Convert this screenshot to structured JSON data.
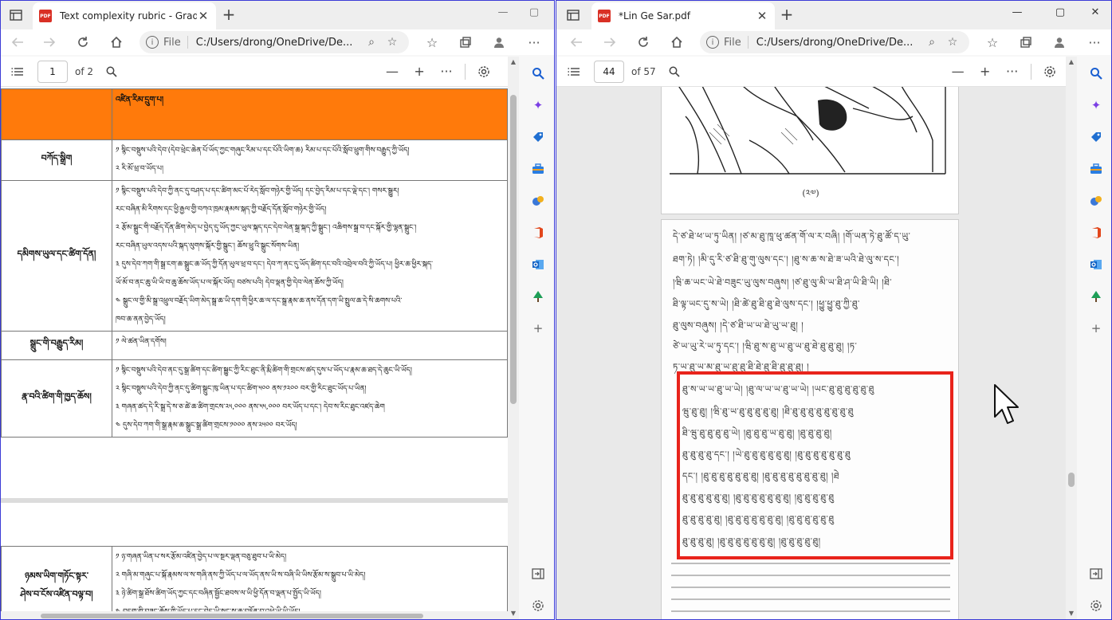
{
  "left_window": {
    "tab_title": "Text complexity rubric - Grade 6",
    "address": {
      "file_label": "File",
      "url": "C:/Users/drong/OneDrive/De..."
    },
    "pdf_toolbar": {
      "page": "1",
      "of": "of 2"
    },
    "document": {
      "header": {
        "col1": "",
        "col2": "འཛིན་རིམ་དྲུག་པ།"
      },
      "rows": [
        {
          "criterion": "བཀོད་སྒྲིག",
          "lines": [
            "༡ སྙིང་བསྡུས་པའི་དེབ་(དེབ་ཕྲེང་ཆེན་པོ་ཡོད་ཀྱང་གཞུང་རིམ་པ་དང་པོའི་ཡིག་ཆ) རིམ་པ་དང་པོའི་སློབ་ཕྲུག་གིས་བརྒྱུད་ཀྱི་ཡོད།",
            "༢ རི་མོ་ཕྲ་བ་ཡོད་པ།"
          ]
        },
        {
          "criterion": "དམིགས་ཡུལ་དང་ཚིག་དོན།",
          "lines": [
            "༡ སྙིང་བསྡུས་པའི་དེབ་ཀྱི་ནང་དུ་བཤད་པ་དང་ཚིག་མང་པོ་རེད་སློབ་གཉེར་གྱི་ཡོད། དང་བྱེད་རིམ་པ་དང་ལྡེ་དང་། གསར་སྒྱུར།",
            "རང་བཞིན་མི་རིགས་དང་ཕྱི་རྒྱལ་གྱི་བཀའ་ཁྲམ་རྣམས་སྐད་ཀྱི་བརྗོད་དོན་སློབ་གཉེར་གྱི་ཡོད།",
            "༢ རྩོམ་སྒྲུང་གི་བརྗོད་དོན་ཚིག་མེད་པ་བྱེད་དུ་ཡོད་ཀྱང་ཡུལ་སྐད་དང་དེབ་ལེན་སྒྲ་སྐད་ཀྱི་སྒྲུང་། འཆིགས་སྒྲ་བ་དང་སྐོར་གྱི་ལྷན་སྒྲུང་།",
            "རང་བཞིན་ཡུལ་འདས་པའི་སྐད་ལུགས་སྐོར་གྱི་སྒྲུང་། ཆོས་ཕྲུ་འི་སྒྲུང་སོགས་ཡིན།",
            "༣ དུས་དེབ་ཀག་གི་སྒྲ་ངག་ཆ་སྒྲུང་ཆ་ཡོད་ཀྱི་དོན་ཡུལ་ཕྲ་བ་དང་། དེབ་ཀ་ནང་དུ་ཡོད་ཚིག་དང་བའི་འབྲེལ་བའི་ཀྱི་ཡོད་པ། ཕྱིར་ཆ་ཕྱིར་སྐད་",
            "ཡོ་མོ་བ་ནང་ཆུ་ཡི་ཡི་བ་ཆུ་ཆོས་ཡོད་པ་ལ་སྐོར་ཡོད། བཙས་པའི། དེབ་ལྡན་གྱི་དེབ་ལེན་ཆོས་ཀྱི་ཡོད།",
            "༤ སྒྲུང་ལ་གྱི་མི་སྒྲ་འཕྲུལ་བརྗོད་ཡིག་མེད་སྒྲ་ཆ་ཡི་དག་གི་ཕྱིར་ཆ་ལ་དང་སྒྲ་རྣམ་ཆ་ནས་དོན་དག་ཡི་སྤྲུལ་ཆ་དེ་སི་ཆགས་པའི་",
            "ཁབ་ཆ་ནན་བྱེད་ཡོད།"
          ]
        },
        {
          "criterion": "སྒྲུང་གི་བརྒྱུད་རིམ།",
          "lines": [
            "༡ ལེ་ཚན་ཡིན་དགོས།"
          ]
        },
        {
          "criterion": "རྣ་བའི་ཚིག་གི་ཁྱད་ཆོས།",
          "lines": [
            "༡ སྙིང་བསྡུས་པའི་དེབ་ནང་དུ་སྒྲ་ཚིག་དང་ཚིག་སྦྱུང་ཀྱི་རིང་ཐུང་ནི་རྨི་ཚིག་གི་གྲངས་ཚད་དུས་པ་ཡོད་པ་རྣམ་ཆ་ཐད་དེ་ཆུང་ཡི་ཡོད།",
            "༢ སྙིང་བསྡུས་པའི་དེབ་ཀྱི་ནང་དུ་ཚིག་སྒྲུང་ཁུ་ཡིན་པ་དང་ཚིག་༥༠༠ ནས་༡༢༠༠ བར་གྱི་རིང་ཐུང་ཡོད་པ་ཡིན།",
            "༣ གཞན་ཚད་དེ་རི་སྒྲ་དེ་ས་ཅ་ཚེ་ཆ་ཚིག་གྲངས་༢༥,༠༠༠ ནས་༥༥,༠༠༠ བར་ཡོད་པ་དང་། དེབ་ས་རིང་ཐུང་འཛད་ཆེག",
            "༤ དུས་དེབ་ཀག་གི་སྒྲ་རྣམ་ཆ་སྒྲུང་སྒྲ་ཚིག་གྲངས་༡༠༠༠ ནས་༢༥༠༠ བར་ཡོད།"
          ]
        }
      ],
      "page2_row": {
        "criterion_line1": "ཉམས་ཡིག་གཏོང་སྟར་",
        "criterion_line2": "ཤེས་བ་ངོས་འཛིན་བལྟ་བ།",
        "lines": [
          "༡ ཉ་གཞན་ཡིན་པ་སར་རྩོམ་འཛིན་བྱེད་པ་ལ་སྔར་ལྡན་བཅུ་ཐུབ་པ་ཡི་མེད།",
          "༢ གཞི་མ་གཞུང་པ་སྐོ་རྣམས་ལ་ས་གཞི་ནས་ཀྱི་ཡོད་པ་ལ་ཡོད་ནས་ཡི་ས་བཞི་ཡི་ཡིས་རྩོམ་ས་སྒྲུབ་པ་ཡི་མེད།",
          "༣ ཉེ་ཚིག་སྒྲ་ཐོས་ཚིག་ཡོད་ཀྱང་དང་བཞིན་སྦྱོང་ཐབས་ལ་ཡི་ཕྱི་དོན་བ་ལྡན་པ་སྤྱོད་ཡི་ཡོད།",
          "༤ བདག་གི་བཟུང་ཆོས་ཀྱི་ཡོད་པ་དང་བྱེད་ཡི་སྒྲུང་ས་ཆ་བཏོན་བ་འཕྱེ་ཡི་ཡི་ཡོད།"
        ]
      }
    }
  },
  "right_window": {
    "tab_title": "*Lin Ge Sar.pdf",
    "address": {
      "file_label": "File",
      "url": "C:/Users/drong/OneDrive/De..."
    },
    "pdf_toolbar": {
      "page": "44",
      "of": "of 57"
    },
    "document": {
      "figure_page_number": "(༢༧)",
      "text_lines_before": [
        "དེ་ཙ་ཐེ་ཕ་ཡ་ཏུ་ཡིན། །ཙ་མ་ཐུ་ཁཱ་ཕུ་ཚན་གོ་ལ་ར་བཞི། །གོ་ཡན་ཏེ་ཐུ་ཚོ་ད་ཡུ་",
        "ཐག་ཏེ། །མི་དུ་རི་ཙ་ཐི་ཐུ་གུ་ལུས་དང་། །ཐུ་ས་ཆ་ས་ཐེ་ཟ་ཡའི་ཐེ་ལུ་ས་དང་།",
        "།ཝི་ཆ་ཡང་ཡེ་ཐེ་བཟུང་ཡུ་ལུས་བཞུས། །ཙ་ཐུ་ལུ་མི་ཡ་ཐི་ཤ་ཡི་ཐི་ཡི། །ཐི་",
        "ཐི་ལྟ་ཡང་དུ་ས་ཡེ། །ཐི་ཚེ་ཐུ་ཐི་ཐུ་ཐེ་ལུས་དང་། །ཕྱུ་ཕྱུ་ཐུ་ཀྱི་ཐུ་",
        "ཐུ་ལུས་བཞུས། །དེ་ཙ་ཐི་ཡ་ཡ་ཐེ་ཡུ་ཡ་ཐུ། །",
        "     ཙེ་ཡ་ཡུ་རེ་ཡ་ཏུ་དང་། །ཝི་ཐུ་ས་ཐུ་ཡ་ཐུ་ཡ་ཐུ་ཐེ་ཐུ་ཐུ་ཐུ། །ཏ་",
        "ཏ་ཡ་ཐུ་ཡ་མ་ཐུ་ཡ་ཐུ་ཐུ་ཐི་ཐེ་ཐུ་ཐི་ཐུ་ཐུ་ཐུ། །"
      ],
      "highlighted_lines": [
        "     ཐུ་ས་ཡ་ཡ་ཐུ་ཡ་ཡེ། །ཐུ་ལ་ཡ་ཡ་ཐུ་ཡ་ཡེ། །ཡང་ཐུ་ཐུ་ཐུ་ཐུ་ཐུ་ཐུ",
        "ཝུ་ཐུ་ཐུ། །ཝི་ཐུ་ཡ་ཐུ་ཐུ་ཐུ་ཐུ་ཐུ། །ཐི་ཐུ་ཐུ་ཐུ་ཐུ་ཐུ་ཐུ་ཐུ་ཐུ",
        "ཐི་ཝུ་ཐུ་ཐུ་ཐུ་ཐུ་ཡེ། །ཐུ་ཐུ་ཐུ་ཡ་ཐུ་ཐུ། །ཐུ་ཐུ་ཐུ་ཐུ།",
        "ཐུ་ཐུ་ཐུ་ཐུ་དང་། །ཡེ་ཐུ་ཐུ་ཐུ་ཐུ་ཐུ་ཐུ། །ཐུ་ཐུ་ཐུ་ཐུ་ཐུ་ཐུ་ཐུ",
        "དང་། །ཐུ་ཐུ་ཐུ་ཐུ་ཐུ་ཐུ་ཐུ། །ཐུ་ཐུ་ཐུ་ཐུ་ཐུ་ཐུ་ཐུ་ཐུ། །ཐེ",
        "ཐུ་ཐུ་ཐུ་ཐུ་ཐུ་ཐུ། །ཐུ་ཐུ་ཐུ་ཐུ་ཐུ་ཐུ་ཐུ། །ཐུ་ཐུ་ཐུ་ཐུ་ཐུ",
        "ཐུ་ཐུ་ཐུ་ཐུ་ཐུ། །ཐུ་ཐུ་ཐུ་ཐུ་ཐུ་ཐུ་ཐུ། །ཐུ་ཐུ་ཐུ་ཐུ་ཐུ་ཐུ",
        "ཐུ་ཐུ་ཐུ་ཐུ། །ཐུ་ཐུ་ཐུ་ཐུ་ཐུ་ཐུ་ཐུ། །ཐུ་ཐུ་ཐུ་ཐུ་ཐུ།"
      ]
    }
  },
  "colors": {
    "accent_border": "#3b3bd6",
    "rubric_header": "#ff7a0b",
    "highlight": "#e8231b"
  }
}
